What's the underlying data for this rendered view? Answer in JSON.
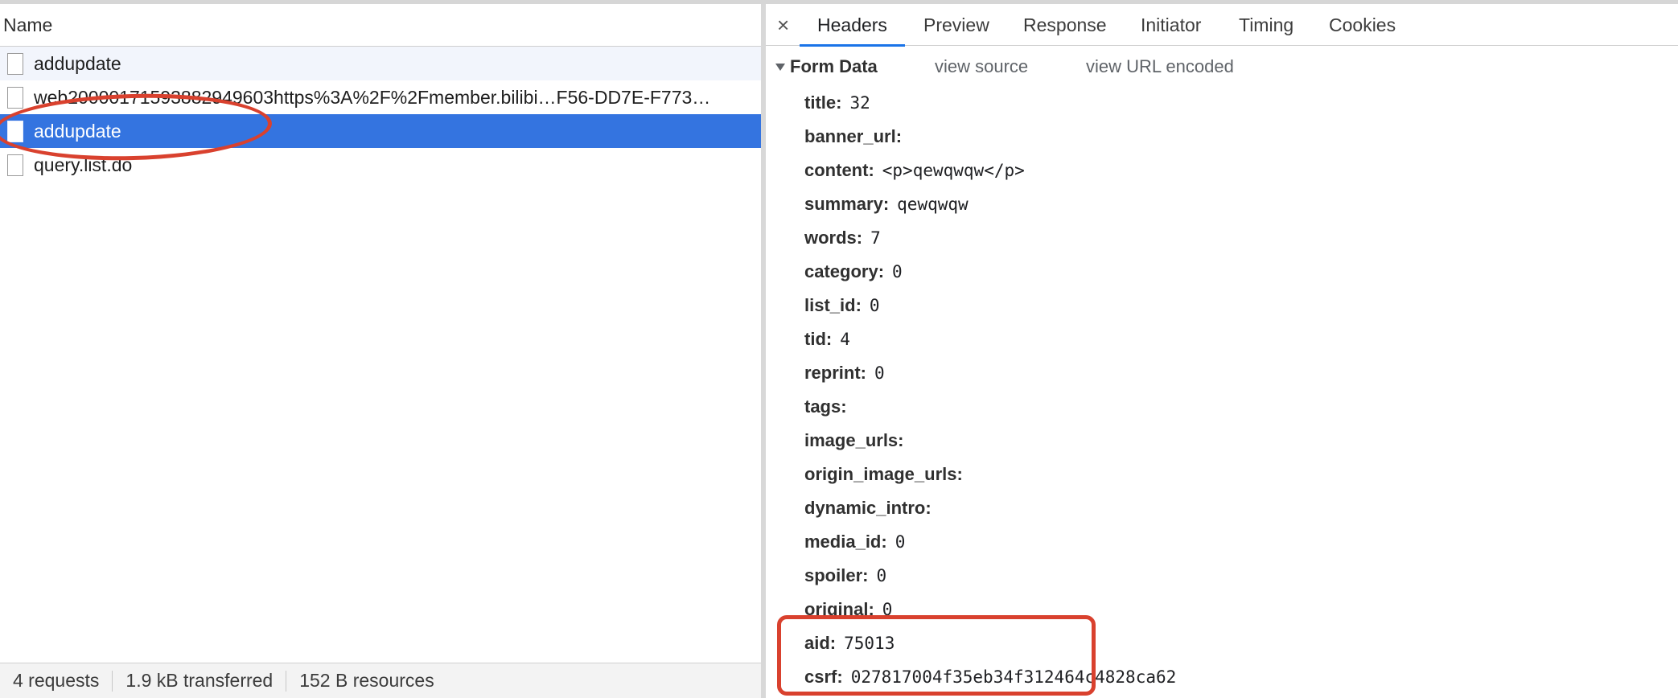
{
  "request_list": {
    "header_label": "Name",
    "items": [
      {
        "name": "addupdate",
        "selected": false
      },
      {
        "name": "web20000171593882949603https%3A%2F%2Fmember.bilibi…F56-DD7E-F773…",
        "selected": false
      },
      {
        "name": "addupdate",
        "selected": true
      },
      {
        "name": "query.list.do",
        "selected": false
      }
    ]
  },
  "status_bar": {
    "requests": "4 requests",
    "transferred": "1.9 kB transferred",
    "resources": "152 B resources"
  },
  "details": {
    "close_glyph": "×",
    "tabs": [
      "Headers",
      "Preview",
      "Response",
      "Initiator",
      "Timing",
      "Cookies"
    ],
    "active_tab": "Headers"
  },
  "form_data": {
    "title": "Form Data",
    "view_source": "view source",
    "view_url_encoded": "view URL encoded",
    "fields": [
      {
        "key": "title:",
        "value": "32"
      },
      {
        "key": "banner_url:",
        "value": ""
      },
      {
        "key": "content:",
        "value": "<p>qewqwqw</p>"
      },
      {
        "key": "summary:",
        "value": "qewqwqw"
      },
      {
        "key": "words:",
        "value": "7"
      },
      {
        "key": "category:",
        "value": "0"
      },
      {
        "key": "list_id:",
        "value": "0"
      },
      {
        "key": "tid:",
        "value": "4"
      },
      {
        "key": "reprint:",
        "value": "0"
      },
      {
        "key": "tags:",
        "value": ""
      },
      {
        "key": "image_urls:",
        "value": ""
      },
      {
        "key": "origin_image_urls:",
        "value": ""
      },
      {
        "key": "dynamic_intro:",
        "value": ""
      },
      {
        "key": "media_id:",
        "value": "0"
      },
      {
        "key": "spoiler:",
        "value": "0"
      },
      {
        "key": "original:",
        "value": "0"
      },
      {
        "key": "aid:",
        "value": "75013"
      },
      {
        "key": "csrf:",
        "value": "027817004f35eb34f312464c4828ca62"
      }
    ]
  },
  "colors": {
    "selected_row": "#3474e0",
    "active_tab_underline": "#1a73e8",
    "annotation": "#d9412e"
  }
}
